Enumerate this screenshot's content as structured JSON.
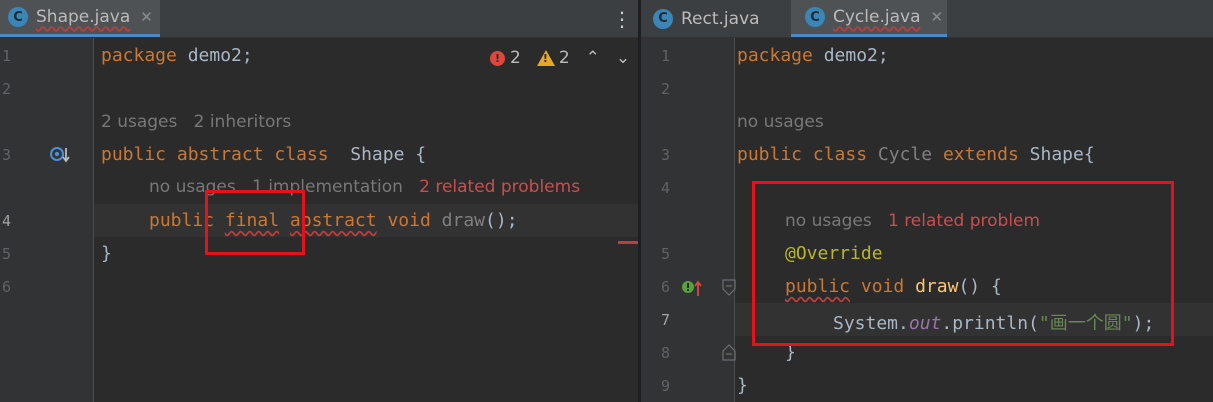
{
  "left": {
    "tabs": [
      {
        "label": "Shape.java",
        "icon": "class-icon",
        "icon_letter": "C",
        "close": "✕",
        "active": true
      }
    ],
    "menu_glyph": "⋮",
    "inspection": {
      "errors": "2",
      "warnings": "2",
      "error_glyph": "!",
      "warning_glyph": "!",
      "up": "⌃",
      "down": "⌄"
    },
    "line_numbers": [
      "1",
      "2",
      "3",
      "4",
      "5",
      "6"
    ],
    "hints": {
      "class_usages": "2 usages",
      "class_inheritors": "2 inheritors",
      "method_usages": "no usages",
      "method_impl": "1 implementation",
      "method_problems": "2 related problems"
    },
    "code": {
      "l1_kw": "package",
      "l1_rest": " demo2;",
      "l3_kw": "public abstract class",
      "l3_rest": "  Shape {",
      "l4_public": "public",
      "l4_final": "final",
      "l4_abstract": "abstract",
      "l4_void": "void",
      "l4_name": "draw",
      "l4_tail": "();",
      "l5": "}"
    }
  },
  "right": {
    "tabs": [
      {
        "label": "Rect.java",
        "icon": "class-icon",
        "icon_letter": "C",
        "active": false
      },
      {
        "label": "Cycle.java",
        "icon": "class-icon",
        "icon_letter": "C",
        "close": "✕",
        "active": true
      }
    ],
    "line_numbers": [
      "1",
      "2",
      "3",
      "4",
      "5",
      "6",
      "7",
      "8",
      "9"
    ],
    "hints": {
      "class_usages": "no usages",
      "method_usages": "no usages",
      "method_problems": "1 related problem"
    },
    "code": {
      "l1_kw": "package",
      "l1_rest": " demo2;",
      "l3_public": "public",
      "l3_class": "class",
      "l3_name": "Cycle",
      "l3_extends": "extends",
      "l3_rest": "Shape{",
      "l5_ann": "@Override",
      "l6_public": "public",
      "l6_void": "void",
      "l6_name": "draw",
      "l6_tail": "() {",
      "l7_system": "System.",
      "l7_out": "out",
      "l7_println": ".println(",
      "l7_str": "\"画一个圆\"",
      "l7_tail": ");",
      "l8": "}",
      "l9": "}"
    }
  },
  "colors": {
    "background": "#2b2b2b",
    "keyword": "#cc7832",
    "annotation": "#bbb529",
    "method": "#ffc66d",
    "string": "#6a8759",
    "error": "#c94f4f",
    "highlight_box": "#e8101a"
  }
}
